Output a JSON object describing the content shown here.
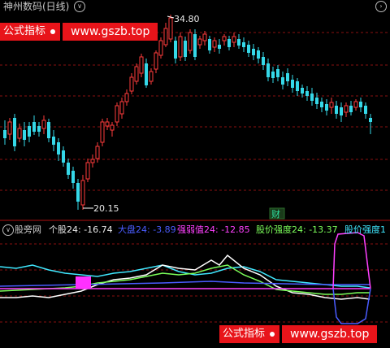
{
  "header": {
    "title": "神州数码(日线)"
  },
  "watermark": {
    "brand": "公式指标",
    "url": "www.gszb.top"
  },
  "main_chart": {
    "high_label": "34.80",
    "low_label": "20.15",
    "event_label": "财",
    "colors": {
      "up": "#ff3c3c",
      "down": "#35d8e8",
      "grid": "#8a1010"
    }
  },
  "indicator": {
    "name": "股旁网",
    "items": [
      {
        "label": "个股24: -16.74",
        "color": "#e8e8e8"
      },
      {
        "label": "大盘24: -3.89",
        "color": "#4a5cff"
      },
      {
        "label": "强弱值24: -12.85",
        "color": "#ff40ff"
      },
      {
        "label": "股价强度24: -13.37",
        "color": "#7cff5a"
      },
      {
        "label": "股价强度1",
        "color": "#40e8ff"
      }
    ]
  }
}
